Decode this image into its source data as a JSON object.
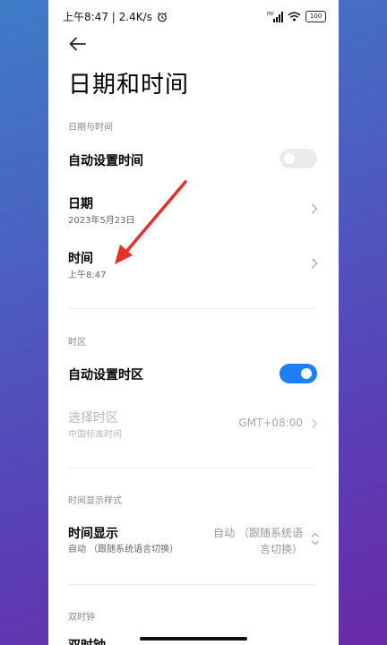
{
  "status_bar": {
    "time": "上午8:47 | 2.4K/s",
    "signal": "HD",
    "battery": "100"
  },
  "page": {
    "title": "日期和时间"
  },
  "sections": {
    "date_time": {
      "header": "日期与时间",
      "auto_time": {
        "label": "自动设置时间",
        "enabled": false
      },
      "date": {
        "label": "日期",
        "value": "2023年5月23日"
      },
      "time": {
        "label": "时间",
        "value": "上午8:47"
      }
    },
    "timezone": {
      "header": "时区",
      "auto_zone": {
        "label": "自动设置时区",
        "enabled": true
      },
      "select_zone": {
        "label": "选择时区",
        "sub": "中国标准时间",
        "value": "GMT+08:00"
      }
    },
    "display_style": {
      "header": "时间显示样式",
      "time_display": {
        "label": "时间显示",
        "sub": "自动 （跟随系统语言切换）",
        "value_line1": "自动 （跟随系统语",
        "value_line2": "言切换）"
      }
    },
    "dual_clock": {
      "header": "双时钟",
      "item": {
        "label": "双时钟"
      }
    }
  },
  "colors": {
    "accent": "#1e7ef5",
    "annotation_arrow": "#e8302a"
  }
}
